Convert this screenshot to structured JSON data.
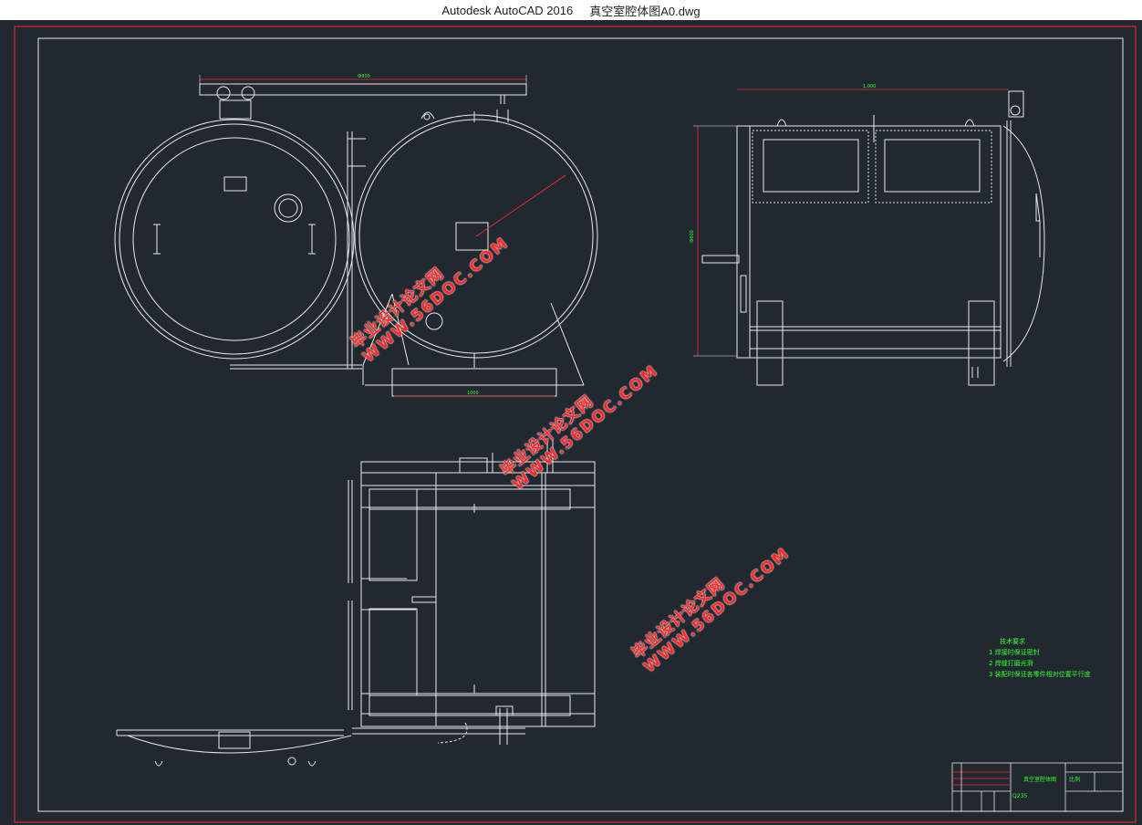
{
  "window": {
    "app_title": "Autodesk AutoCAD 2016",
    "file_name": "真空室腔体图A0.dwg"
  },
  "drawing": {
    "dimensions": {
      "front_width": "Ф800",
      "side_length": "1,000",
      "side_height": "Ф800",
      "base_width": "1000"
    },
    "notes": {
      "heading": "技术要求",
      "items": [
        "1 焊接时保证密封",
        "2 焊缝打磨光滑",
        "3 装配时保证各零件相对位置平行度"
      ]
    },
    "title_block": {
      "drawing_name": "真空室腔体图",
      "scale_label": "比例",
      "material": "Q235"
    }
  },
  "watermark": {
    "cn": "毕业设计论文网",
    "url": "WWW.56DOC.COM"
  },
  "colors": {
    "canvas": "#212830",
    "lines": "#e8e8e8",
    "border": "#ff2a2a",
    "dimension": "#ff2a2a",
    "text": "#33ff33"
  }
}
